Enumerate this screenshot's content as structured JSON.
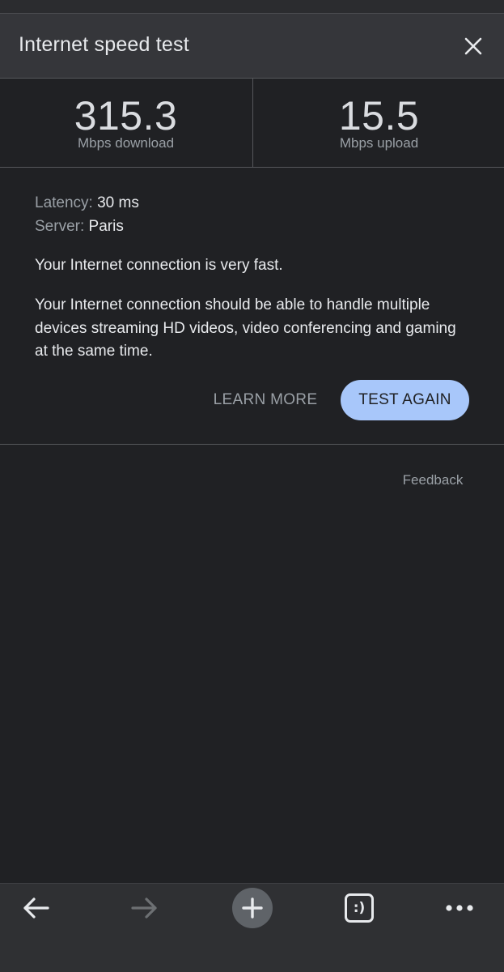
{
  "header": {
    "title": "Internet speed test",
    "close_icon": "close-icon"
  },
  "metrics": {
    "download": {
      "value": "315.3",
      "unit": "Mbps download"
    },
    "upload": {
      "value": "15.5",
      "unit": "Mbps upload"
    }
  },
  "details": {
    "latency_label": "Latency:",
    "latency_value": "30 ms",
    "server_label": "Server:",
    "server_value": "Paris",
    "summary": "Your Internet connection is very fast.",
    "description": "Your Internet connection should be able to handle multiple devices streaming HD videos, video conferencing and gaming at the same time."
  },
  "actions": {
    "learn_more": "LEARN MORE",
    "test_again": "TEST AGAIN"
  },
  "feedback": "Feedback",
  "bottom_nav": {
    "back_icon": "arrow-left-icon",
    "forward_icon": "arrow-right-icon",
    "new_tab_icon": "plus-icon",
    "tabs_badge": ":)",
    "menu_icon": "more-horizontal-icon"
  },
  "colors": {
    "background": "#202124",
    "header": "#35363a",
    "accent_button": "#a8c7fa",
    "text_primary": "#e8eaed",
    "text_secondary": "#9aa0a6"
  }
}
